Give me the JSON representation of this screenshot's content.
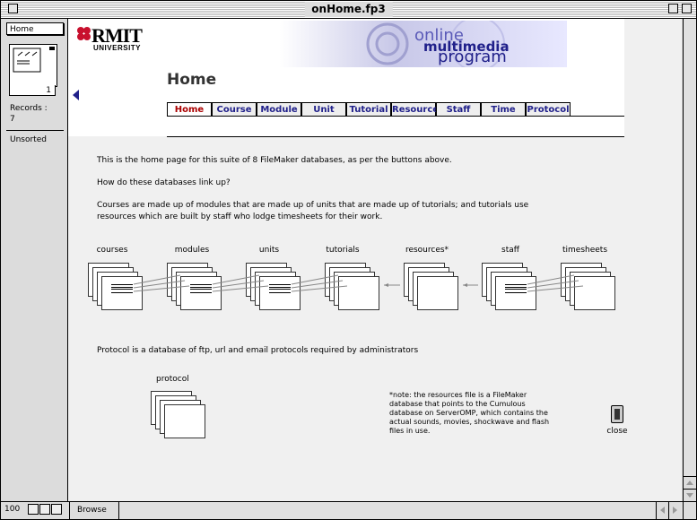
{
  "window": {
    "title": "onHome.fp3"
  },
  "status_area": {
    "layout": "Home",
    "book_page": "1",
    "records_label": "Records :",
    "records_count": "7",
    "sort_status": "Unsorted"
  },
  "header": {
    "logo_main": "RMIT",
    "logo_sub": "UNIVERSITY",
    "banner_line1": "online",
    "banner_line2": "multimedia",
    "banner_line3": "program",
    "page_title": "Home"
  },
  "tabs": [
    {
      "label": "Home",
      "active": true
    },
    {
      "label": "Course"
    },
    {
      "label": "Module"
    },
    {
      "label": "Unit"
    },
    {
      "label": "Tutorial"
    },
    {
      "label": "Resource"
    },
    {
      "label": "Staff"
    },
    {
      "label": "Time"
    },
    {
      "label": "Protocol"
    }
  ],
  "body": {
    "para1": "This is the home page for this suite of 8 FileMaker databases, as per the buttons above.",
    "para2": "How do these databases link up?",
    "para3": "Courses are made up of modules that are made up of units that are made up of tutorials; and tutorials use resources which are built by staff who lodge timesheets for their work.",
    "para4": "Protocol is a database of ftp, url and email protocols required by administrators"
  },
  "diagram": {
    "labels": [
      "courses",
      "modules",
      "units",
      "tutorials",
      "resources*",
      "staff",
      "timesheets"
    ],
    "protocol_label": "protocol"
  },
  "note": "*note: the resources file is a FileMaker database that points to the Cumulous database on ServerOMP, which contains the actual sounds, movies, shockwave and flash files in use.",
  "close_label": "close",
  "bottom": {
    "zoom": "100",
    "mode": "Browse"
  }
}
